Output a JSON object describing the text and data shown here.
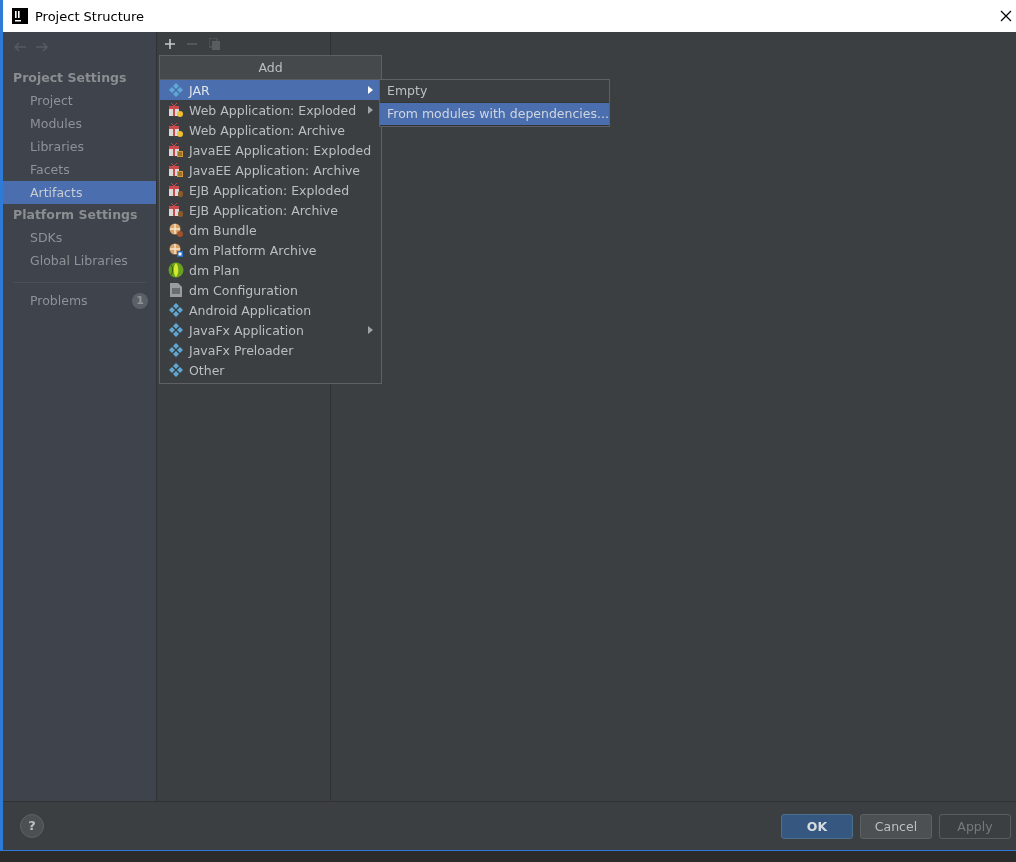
{
  "window": {
    "title": "Project Structure"
  },
  "sidebar": {
    "sections": [
      {
        "title": "Project Settings",
        "items": [
          {
            "label": "Project",
            "selected": false
          },
          {
            "label": "Modules",
            "selected": false
          },
          {
            "label": "Libraries",
            "selected": false
          },
          {
            "label": "Facets",
            "selected": false
          },
          {
            "label": "Artifacts",
            "selected": true
          }
        ]
      },
      {
        "title": "Platform Settings",
        "items": [
          {
            "label": "SDKs",
            "selected": false
          },
          {
            "label": "Global Libraries",
            "selected": false
          }
        ]
      }
    ],
    "problems": {
      "label": "Problems",
      "count": "1"
    }
  },
  "toolbar": {
    "add_disabled": false,
    "remove_disabled": true,
    "copy_disabled": true
  },
  "add_menu": {
    "title": "Add",
    "items": [
      {
        "label": "JAR",
        "kind": "jar",
        "submenu": true,
        "selected": true
      },
      {
        "label": "Web Application: Exploded",
        "kind": "web",
        "submenu": true,
        "selected": false
      },
      {
        "label": "Web Application: Archive",
        "kind": "web",
        "submenu": false,
        "selected": false
      },
      {
        "label": "JavaEE Application: Exploded",
        "kind": "javaee",
        "submenu": false,
        "selected": false
      },
      {
        "label": "JavaEE Application: Archive",
        "kind": "javaee",
        "submenu": false,
        "selected": false
      },
      {
        "label": "EJB Application: Exploded",
        "kind": "ejb",
        "submenu": false,
        "selected": false
      },
      {
        "label": "EJB Application: Archive",
        "kind": "ejb",
        "submenu": false,
        "selected": false
      },
      {
        "label": "dm Bundle",
        "kind": "bundle",
        "submenu": false,
        "selected": false
      },
      {
        "label": "dm Platform Archive",
        "kind": "platform",
        "submenu": false,
        "selected": false
      },
      {
        "label": "dm Plan",
        "kind": "plan",
        "submenu": false,
        "selected": false
      },
      {
        "label": "dm Configuration",
        "kind": "config",
        "submenu": false,
        "selected": false
      },
      {
        "label": "Android Application",
        "kind": "jar",
        "submenu": false,
        "selected": false
      },
      {
        "label": "JavaFx Application",
        "kind": "jar",
        "submenu": true,
        "selected": false
      },
      {
        "label": "JavaFx Preloader",
        "kind": "jar",
        "submenu": false,
        "selected": false
      },
      {
        "label": "Other",
        "kind": "jar",
        "submenu": false,
        "selected": false
      }
    ]
  },
  "jar_submenu": {
    "items": [
      {
        "label": "Empty",
        "selected": false
      },
      {
        "label": "From modules with dependencies...",
        "selected": true
      }
    ]
  },
  "footer": {
    "help": "?",
    "buttons": [
      {
        "label": "OK",
        "kind": "default",
        "disabled": false
      },
      {
        "label": "Cancel",
        "kind": "normal",
        "disabled": false
      },
      {
        "label": "Apply",
        "kind": "normal",
        "disabled": true
      }
    ]
  }
}
